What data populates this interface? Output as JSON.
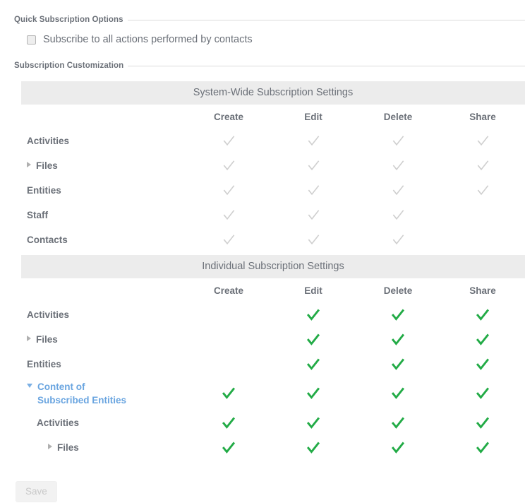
{
  "quick_section": {
    "legend": "Quick Subscription Options",
    "checkbox": {
      "label": "Subscribe to all actions performed by contacts",
      "checked": false
    }
  },
  "customization_section": {
    "legend": "Subscription Customization"
  },
  "columns": [
    "Create",
    "Edit",
    "Delete",
    "Share"
  ],
  "tables": [
    {
      "title": "System-Wide Subscription Settings",
      "check_style": "gray",
      "rows": [
        {
          "label": "Activities",
          "indent": 0,
          "toggle": "none",
          "link": false,
          "checks": [
            true,
            true,
            true,
            true
          ]
        },
        {
          "label": "Files",
          "indent": 1,
          "toggle": "right",
          "link": false,
          "checks": [
            true,
            true,
            true,
            true
          ]
        },
        {
          "label": "Entities",
          "indent": 0,
          "toggle": "none",
          "link": false,
          "checks": [
            true,
            true,
            true,
            true
          ]
        },
        {
          "label": "Staff",
          "indent": 0,
          "toggle": "none",
          "link": false,
          "checks": [
            true,
            true,
            true,
            false
          ]
        },
        {
          "label": "Contacts",
          "indent": 0,
          "toggle": "none",
          "link": false,
          "checks": [
            true,
            true,
            true,
            false
          ]
        }
      ]
    },
    {
      "title": "Individual Subscription Settings",
      "check_style": "green",
      "rows": [
        {
          "label": "Activities",
          "indent": 0,
          "toggle": "none",
          "link": false,
          "checks": [
            false,
            true,
            true,
            true
          ]
        },
        {
          "label": "Files",
          "indent": 1,
          "toggle": "right",
          "link": false,
          "checks": [
            false,
            true,
            true,
            true
          ]
        },
        {
          "label": "Entities",
          "indent": 0,
          "toggle": "none",
          "link": false,
          "checks": [
            false,
            true,
            true,
            true
          ]
        },
        {
          "label": "Content of Subscribed Entities",
          "indent": 1,
          "toggle": "down",
          "link": true,
          "checks": [
            true,
            true,
            true,
            true
          ]
        },
        {
          "label": "Activities",
          "indent": 2,
          "toggle": "none",
          "link": false,
          "checks": [
            true,
            true,
            true,
            true
          ]
        },
        {
          "label": "Files",
          "indent": 3,
          "toggle": "right",
          "link": false,
          "checks": [
            true,
            true,
            true,
            true
          ]
        }
      ]
    }
  ],
  "footer": {
    "save_label": "Save",
    "save_disabled": true
  },
  "colors": {
    "check_green": "#22ab46",
    "check_gray": "#cfcfcf",
    "link_blue": "#6aa5e0",
    "header_bg": "#ececec",
    "text": "#6b7078"
  }
}
